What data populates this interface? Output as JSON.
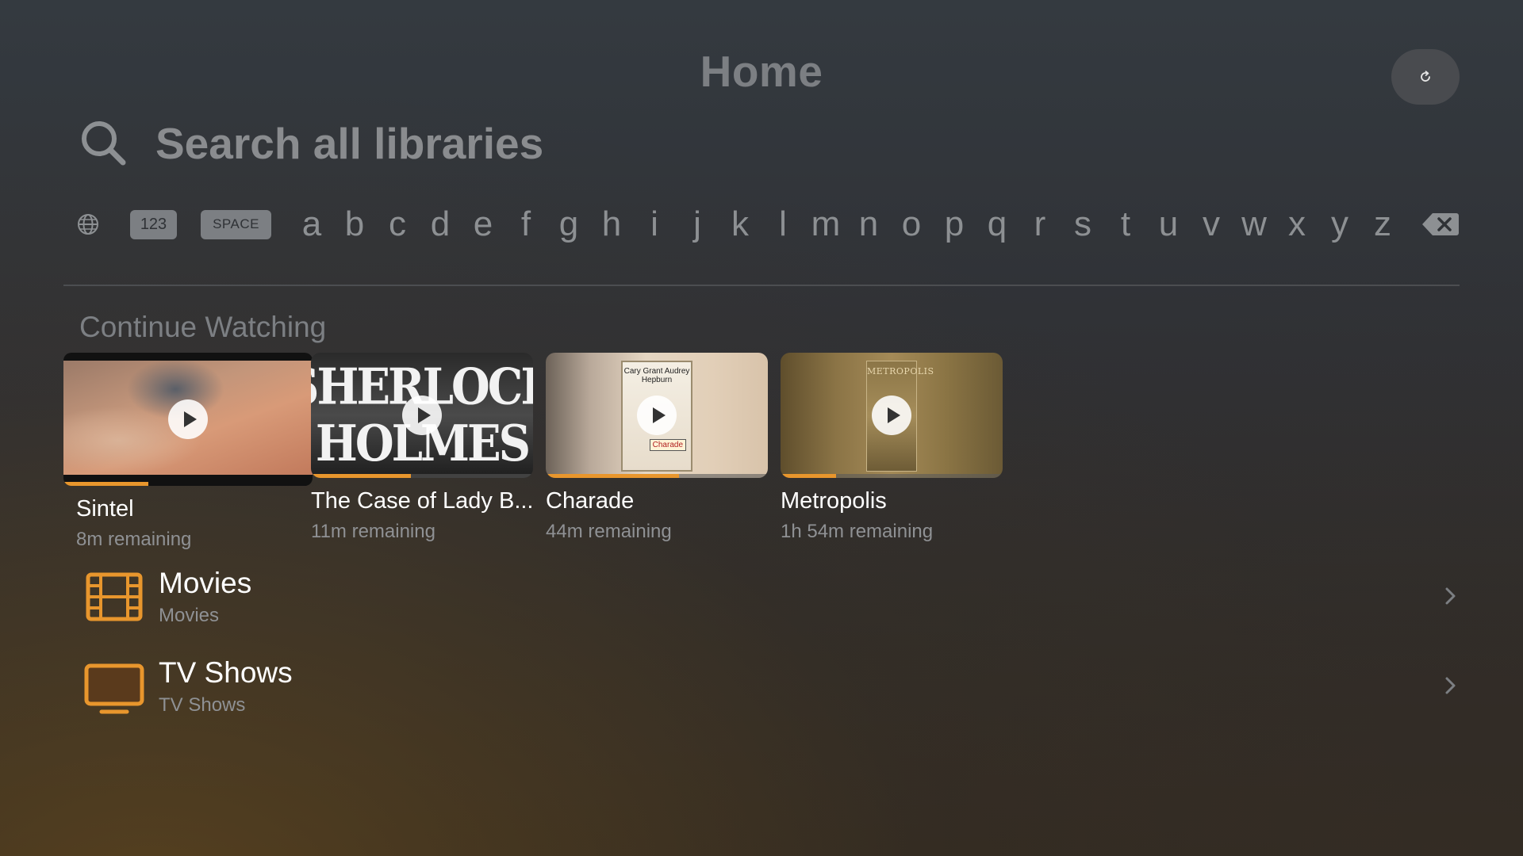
{
  "header": {
    "title": "Home",
    "refresh_icon": "refresh-icon"
  },
  "search": {
    "placeholder": "Search all libraries",
    "icon": "search-icon"
  },
  "keyboard": {
    "globe_icon": "globe-icon",
    "numbers_label": "123",
    "space_label": "SPACE",
    "letters": [
      "a",
      "b",
      "c",
      "d",
      "e",
      "f",
      "g",
      "h",
      "i",
      "j",
      "k",
      "l",
      "m",
      "n",
      "o",
      "p",
      "q",
      "r",
      "s",
      "t",
      "u",
      "v",
      "w",
      "x",
      "y",
      "z"
    ],
    "backspace_icon": "backspace-icon"
  },
  "continue_watching": {
    "title": "Continue Watching",
    "items": [
      {
        "title": "Sintel",
        "remaining": "8m remaining",
        "progress": 0.34,
        "art_text": ""
      },
      {
        "title": "The Case of Lady B...",
        "remaining": "11m remaining",
        "progress": 0.45,
        "art_text": "SHERLOCK HOLMES"
      },
      {
        "title": "Charade",
        "remaining": "44m remaining",
        "progress": 0.6,
        "art_text": "Cary Grant Audrey Hepburn"
      },
      {
        "title": "Metropolis",
        "remaining": "1h 54m remaining",
        "progress": 0.25,
        "art_text": "METROPOLIS"
      }
    ]
  },
  "libraries": [
    {
      "title": "Movies",
      "subtitle": "Movies",
      "icon": "film-icon"
    },
    {
      "title": "TV Shows",
      "subtitle": "TV Shows",
      "icon": "tv-icon"
    }
  ],
  "colors": {
    "accent": "#e8962d",
    "muted_text": "#8f9194"
  }
}
